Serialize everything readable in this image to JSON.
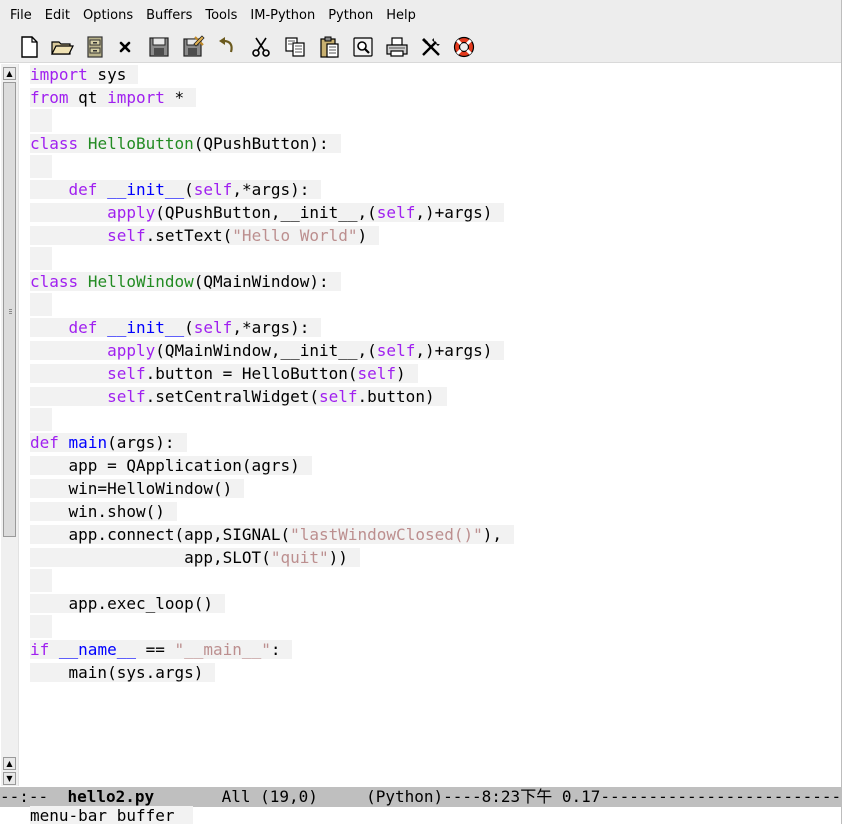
{
  "menubar": {
    "items": [
      "File",
      "Edit",
      "Options",
      "Buffers",
      "Tools",
      "IM-Python",
      "Python",
      "Help"
    ]
  },
  "toolbar": {
    "buttons": [
      {
        "icon": "new-file-icon",
        "name": "new-file-button"
      },
      {
        "icon": "open-folder-icon",
        "name": "open-folder-button"
      },
      {
        "icon": "dired-cabinet-icon",
        "name": "dired-button"
      },
      {
        "icon": "close-icon",
        "name": "close-buffer-button"
      },
      {
        "icon": "save-icon",
        "name": "save-button"
      },
      {
        "icon": "save-as-icon",
        "name": "save-as-button"
      },
      {
        "icon": "undo-icon",
        "name": "undo-button"
      },
      {
        "icon": "cut-icon",
        "name": "cut-button"
      },
      {
        "icon": "copy-icon",
        "name": "copy-button"
      },
      {
        "icon": "paste-icon",
        "name": "paste-button"
      },
      {
        "icon": "search-icon",
        "name": "search-button"
      },
      {
        "icon": "print-icon",
        "name": "print-button"
      },
      {
        "icon": "preferences-icon",
        "name": "preferences-button"
      },
      {
        "icon": "help-lifebuoy-icon",
        "name": "help-button"
      }
    ]
  },
  "editor": {
    "lines": [
      [
        {
          "t": "import",
          "c": "kw"
        },
        {
          "t": " sys",
          "c": ""
        }
      ],
      [
        {
          "t": "from",
          "c": "kw"
        },
        {
          "t": " qt ",
          "c": ""
        },
        {
          "t": "import",
          "c": "kw"
        },
        {
          "t": " *",
          "c": ""
        }
      ],
      [],
      [
        {
          "t": "class",
          "c": "kw"
        },
        {
          "t": " ",
          "c": ""
        },
        {
          "t": "HelloButton",
          "c": "ty"
        },
        {
          "t": "(QPushButton):",
          "c": ""
        }
      ],
      [],
      [
        {
          "t": "    ",
          "c": ""
        },
        {
          "t": "def",
          "c": "kw"
        },
        {
          "t": " ",
          "c": ""
        },
        {
          "t": "__init__",
          "c": "fn"
        },
        {
          "t": "(",
          "c": ""
        },
        {
          "t": "self",
          "c": "kw"
        },
        {
          "t": ",*args):",
          "c": ""
        }
      ],
      [
        {
          "t": "        ",
          "c": ""
        },
        {
          "t": "apply",
          "c": "kw"
        },
        {
          "t": "(QPushButton,__init__,(",
          "c": ""
        },
        {
          "t": "self",
          "c": "kw"
        },
        {
          "t": ",)+args)",
          "c": ""
        }
      ],
      [
        {
          "t": "        ",
          "c": ""
        },
        {
          "t": "self",
          "c": "kw"
        },
        {
          "t": ".setText(",
          "c": ""
        },
        {
          "t": "\"Hello World\"",
          "c": "str"
        },
        {
          "t": ")",
          "c": ""
        }
      ],
      [],
      [
        {
          "t": "class",
          "c": "kw"
        },
        {
          "t": " ",
          "c": ""
        },
        {
          "t": "HelloWindow",
          "c": "ty"
        },
        {
          "t": "(QMainWindow):",
          "c": ""
        }
      ],
      [],
      [
        {
          "t": "    ",
          "c": ""
        },
        {
          "t": "def",
          "c": "kw"
        },
        {
          "t": " ",
          "c": ""
        },
        {
          "t": "__init__",
          "c": "fn"
        },
        {
          "t": "(",
          "c": ""
        },
        {
          "t": "self",
          "c": "kw"
        },
        {
          "t": ",*args):",
          "c": ""
        }
      ],
      [
        {
          "t": "        ",
          "c": ""
        },
        {
          "t": "apply",
          "c": "kw"
        },
        {
          "t": "(QMainWindow,__init__,(",
          "c": ""
        },
        {
          "t": "self",
          "c": "kw"
        },
        {
          "t": ",)+args)",
          "c": ""
        }
      ],
      [
        {
          "t": "        ",
          "c": ""
        },
        {
          "t": "self",
          "c": "kw"
        },
        {
          "t": ".button = HelloButton(",
          "c": ""
        },
        {
          "t": "self",
          "c": "kw"
        },
        {
          "t": ")",
          "c": ""
        }
      ],
      [
        {
          "t": "        ",
          "c": ""
        },
        {
          "t": "self",
          "c": "kw"
        },
        {
          "t": ".setCentralWidget(",
          "c": ""
        },
        {
          "t": "self",
          "c": "kw"
        },
        {
          "t": ".button)",
          "c": ""
        }
      ],
      [],
      [
        {
          "t": "def",
          "c": "kw"
        },
        {
          "t": " ",
          "c": ""
        },
        {
          "t": "main",
          "c": "fn"
        },
        {
          "t": "(args):",
          "c": ""
        }
      ],
      [
        {
          "t": "    app = QApplication(agrs)",
          "c": ""
        }
      ],
      [
        {
          "t": "    win=HelloWindow()",
          "c": ""
        }
      ],
      [
        {
          "t": "    win.show()",
          "c": ""
        }
      ],
      [
        {
          "t": "    app.connect(app,SIGNAL(",
          "c": ""
        },
        {
          "t": "\"lastWindowClosed()\"",
          "c": "str"
        },
        {
          "t": "),",
          "c": ""
        }
      ],
      [
        {
          "t": "                app,SLOT(",
          "c": ""
        },
        {
          "t": "\"quit\"",
          "c": "str"
        },
        {
          "t": "))",
          "c": ""
        }
      ],
      [],
      [
        {
          "t": "    app.exec_loop()",
          "c": ""
        }
      ],
      [],
      [
        {
          "t": "if",
          "c": "kw"
        },
        {
          "t": " ",
          "c": ""
        },
        {
          "t": "__name__",
          "c": "fn"
        },
        {
          "t": " == ",
          "c": ""
        },
        {
          "t": "\"__main__\"",
          "c": "str"
        },
        {
          "t": ":",
          "c": ""
        }
      ],
      [
        {
          "t": "    main(sys.args)",
          "c": ""
        }
      ]
    ]
  },
  "modeline": {
    "prefix": "--:--  ",
    "buffer_name": "hello2.py",
    "position": "       All (19,0)     ",
    "mode": "(Python)----8:23下午 0.17",
    "fill": "----------------------------------------"
  },
  "echo_area": {
    "text": "menu-bar buffer"
  },
  "colors": {
    "keyword": "#a020f0",
    "function": "#0000ff",
    "type": "#228b22",
    "string": "#bc8f8f",
    "modeline_bg": "#bfbfbf"
  }
}
